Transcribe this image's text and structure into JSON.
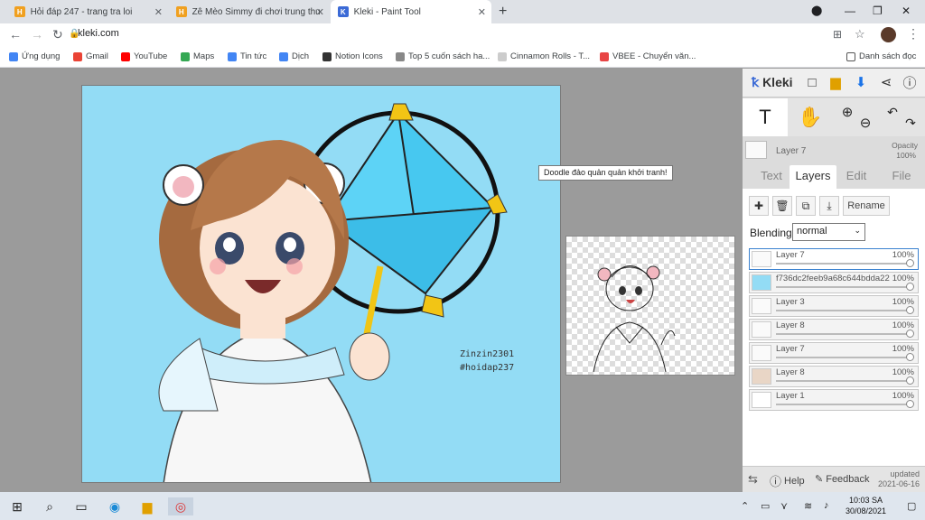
{
  "tabs": [
    {
      "title": "Hỏi đáp 247 - trang tra loi",
      "active": false,
      "fav_color": "#f0a020",
      "fav": "H"
    },
    {
      "title": "Zê Mèo Simmy đi chơi trung thu",
      "active": false,
      "fav_color": "#f0a020",
      "fav": "H"
    },
    {
      "title": "Kleki - Paint Tool",
      "active": true,
      "fav_color": "#3b6ad6",
      "fav": "K"
    }
  ],
  "address": {
    "url": "kleki.com"
  },
  "bookmarks": [
    {
      "label": "Ứng dụng",
      "color": "#4285f4"
    },
    {
      "label": "Gmail",
      "color": "#ea4335"
    },
    {
      "label": "YouTube",
      "color": "#ff0000"
    },
    {
      "label": "Maps",
      "color": "#34a853"
    },
    {
      "label": "Tin tức",
      "color": "#4285f4"
    },
    {
      "label": "Dịch",
      "color": "#4285f4"
    },
    {
      "label": "Notion Icons",
      "color": "#333333"
    },
    {
      "label": "Top 5 cuốn sách ha...",
      "color": "#888888"
    },
    {
      "label": "Cinnamon Rolls - T...",
      "color": "#cccccc"
    },
    {
      "label": "VBEE - Chuyển văn...",
      "color": "#e84545"
    }
  ],
  "reading_list": "Danh sách đọc",
  "artwork": {
    "signature1": "Zinzin2301",
    "signature2": "#hoidap237"
  },
  "tooltip": "Doodle đảo quản quản khởi tranh!",
  "kleki": {
    "logo": "Kleki",
    "current_layer": "Layer 7",
    "opacity_label": "Opacity",
    "opacity_value": "100%",
    "tabs": [
      "Text",
      "Layers",
      "Edit",
      "File"
    ],
    "rename": "Rename",
    "blending_label": "Blending",
    "blending_value": "normal",
    "layers": [
      {
        "name": "Layer 7",
        "opacity": "100%",
        "selected": true
      },
      {
        "name": "f736dc2feeb9a68c644bdda22",
        "opacity": "100%",
        "selected": false
      },
      {
        "name": "Layer 3",
        "opacity": "100%",
        "selected": false
      },
      {
        "name": "Layer 8",
        "opacity": "100%",
        "selected": false
      },
      {
        "name": "Layer 7",
        "opacity": "100%",
        "selected": false
      },
      {
        "name": "Layer 8",
        "opacity": "100%",
        "selected": false
      },
      {
        "name": "Layer 1",
        "opacity": "100%",
        "selected": false
      }
    ],
    "help": "Help",
    "feedback": "Feedback",
    "updated_label": "updated",
    "updated_date": "2021-06-16"
  },
  "taskbar": {
    "time": "10:03 SA",
    "date": "30/08/2021"
  }
}
